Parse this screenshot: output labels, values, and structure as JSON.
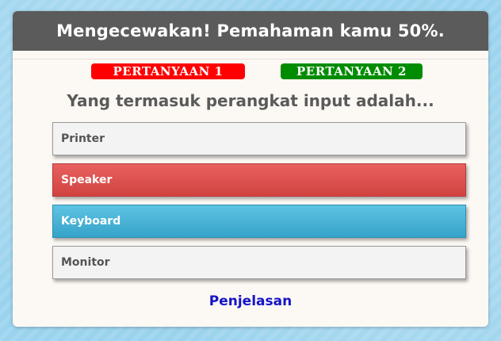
{
  "result": {
    "message": "Mengecewakan! Pemahaman kamu 50%.",
    "score_percent": 50
  },
  "question_nav": [
    {
      "label": "PERTANYAAN 1",
      "status": "wrong",
      "color": "#ff0000"
    },
    {
      "label": "PERTANYAAN 2",
      "status": "correct",
      "color": "#008c00"
    }
  ],
  "question": {
    "text": "Yang termasuk perangkat input adalah...",
    "options": [
      {
        "label": "Printer",
        "state": "neutral"
      },
      {
        "label": "Speaker",
        "state": "wrong",
        "color": "#d94f4d"
      },
      {
        "label": "Keyboard",
        "state": "correct",
        "color": "#46b2d6"
      },
      {
        "label": "Monitor",
        "state": "neutral"
      }
    ]
  },
  "explanation_link": "Penjelasan",
  "colors": {
    "result_bar": "#5b5b5b",
    "panel_background": "#fcf8f4",
    "page_background": "#9ad3ee",
    "link": "#1414c8"
  }
}
